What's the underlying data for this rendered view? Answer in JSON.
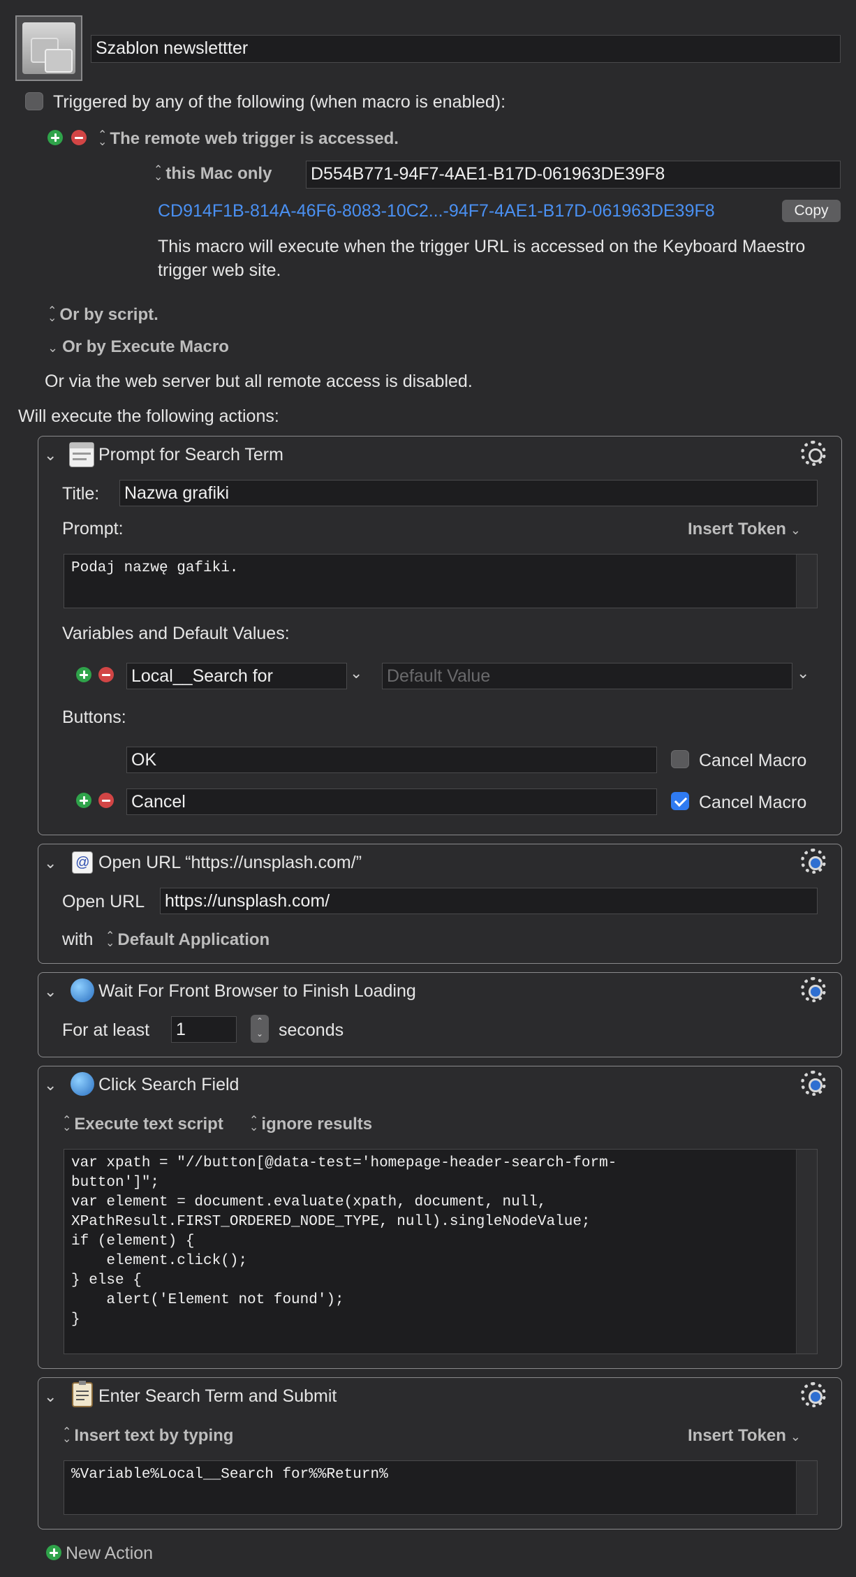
{
  "macro": {
    "name": "Szablon newslettter"
  },
  "trigger": {
    "header_label": "Triggered by any of the following (when macro is enabled):",
    "remote": {
      "title": "The remote web trigger is accessed.",
      "scope": "this Mac only",
      "uuid": "D554B771-94F7-4AE1-B17D-061963DE39F8",
      "url_link": "CD914F1B-814A-46F6-8083-10C2...-94F7-4AE1-B17D-061963DE39F8",
      "copy_label": "Copy",
      "description": "This macro will execute when the trigger URL is accessed on the Keyboard Maestro trigger web site."
    },
    "or_script": "Or by script.",
    "or_execute": "Or by Execute Macro",
    "or_web": "Or via the web server but all remote access is disabled."
  },
  "actions_header": "Will execute the following actions:",
  "actions": {
    "prompt": {
      "title": "Prompt for Search Term",
      "title_label": "Title:",
      "title_value": "Nazwa grafiki",
      "prompt_label": "Prompt:",
      "insert_token": "Insert Token",
      "prompt_value": "Podaj nazwę gafiki.",
      "vars_label": "Variables and Default Values:",
      "var_name": "Local__Search for",
      "default_placeholder": "Default Value",
      "buttons_label": "Buttons:",
      "button1": "OK",
      "button1_cancel": "Cancel Macro",
      "button1_checked": false,
      "button2": "Cancel",
      "button2_cancel": "Cancel Macro",
      "button2_checked": true
    },
    "open_url": {
      "title": "Open URL “https://unsplash.com/”",
      "label": "Open URL",
      "value": "https://unsplash.com/",
      "with_label": "with",
      "app": "Default Application"
    },
    "wait": {
      "title": "Wait For Front Browser to Finish Loading",
      "label": "For at least",
      "value": "1",
      "unit": "seconds"
    },
    "click": {
      "title": "Click Search Field",
      "exec": "Execute text script",
      "results": "ignore results",
      "script": "var xpath = \"//button[@data-test='homepage-header-search-form-\nbutton']\";\nvar element = document.evaluate(xpath, document, null,\nXPathResult.FIRST_ORDERED_NODE_TYPE, null).singleNodeValue;\nif (element) {\n    element.click();\n} else {\n    alert('Element not found');\n}"
    },
    "enter": {
      "title": "Enter Search Term and Submit",
      "mode": "Insert text by typing",
      "insert_token": "Insert Token",
      "value": "%Variable%Local__Search for%%Return%"
    }
  },
  "new_action": "New Action",
  "icons": {
    "checkbox": "checkbox-icon",
    "add": "add-icon",
    "remove": "remove-icon",
    "gear": "gear-icon",
    "chevron": "chevron-down-icon",
    "updown": "up-down-icon",
    "window": "window-icon",
    "at": "at-sign-icon",
    "globe": "globe-icon",
    "clipboard": "clipboard-icon"
  },
  "colors": {
    "background": "#2a2a2c",
    "link": "#4a90f2",
    "checked": "#2f7bf2",
    "add": "#2fa34a",
    "remove": "#d24545"
  }
}
